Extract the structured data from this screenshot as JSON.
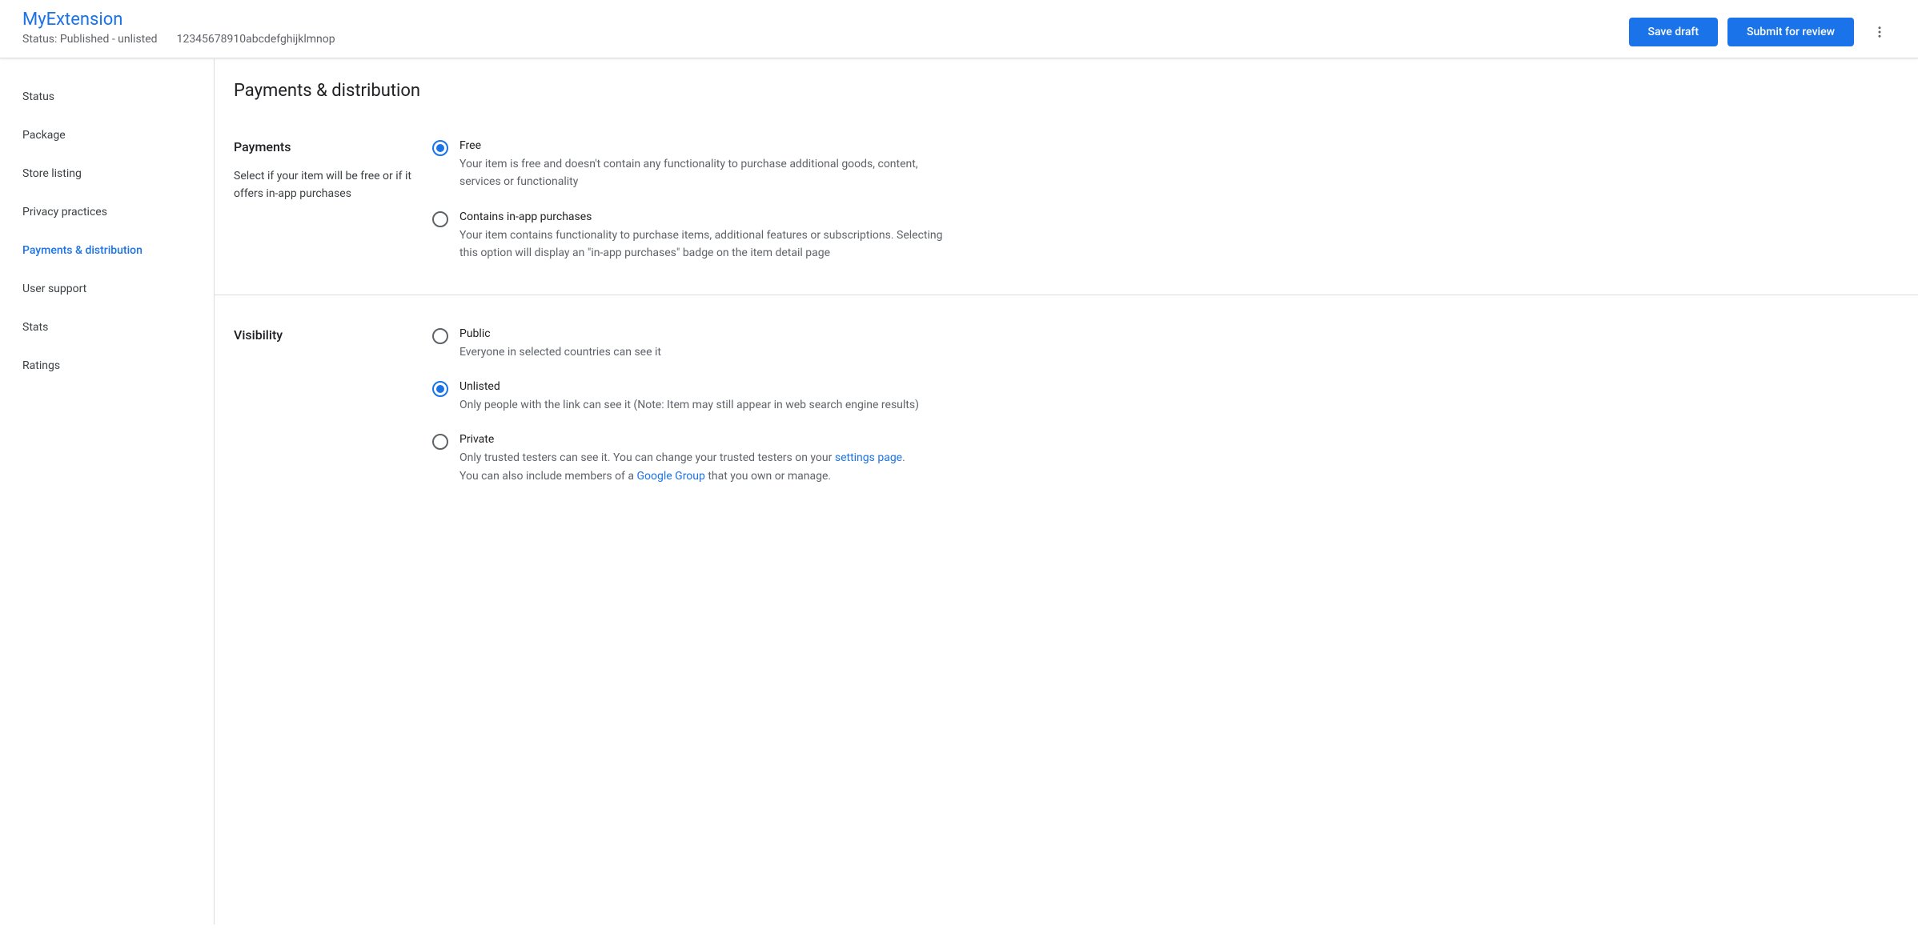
{
  "header": {
    "title": "MyExtension",
    "status": "Status: Published - unlisted",
    "id": "12345678910abcdefghijklmnop",
    "saveDraft": "Save draft",
    "submitReview": "Submit for review"
  },
  "sidebar": {
    "items": [
      {
        "label": "Status",
        "active": false
      },
      {
        "label": "Package",
        "active": false
      },
      {
        "label": "Store listing",
        "active": false
      },
      {
        "label": "Privacy practices",
        "active": false
      },
      {
        "label": "Payments & distribution",
        "active": true
      },
      {
        "label": "User support",
        "active": false
      },
      {
        "label": "Stats",
        "active": false
      },
      {
        "label": "Ratings",
        "active": false
      }
    ]
  },
  "main": {
    "title": "Payments & distribution",
    "payments": {
      "label": "Payments",
      "desc": "Select if your item will be free or if it offers in-app purchases",
      "options": [
        {
          "title": "Free",
          "desc": "Your item is free and doesn't contain any functionality to purchase additional goods, content, services or functionality",
          "checked": true
        },
        {
          "title": "Contains in-app purchases",
          "desc": "Your item contains functionality to purchase items, additional features or subscriptions. Selecting this option will display an \"in-app purchases\" badge on the item detail page",
          "checked": false
        }
      ]
    },
    "visibility": {
      "label": "Visibility",
      "options": [
        {
          "title": "Public",
          "desc": "Everyone in selected countries can see it",
          "checked": false
        },
        {
          "title": "Unlisted",
          "desc": "Only people with the link can see it (Note: Item may still appear in web search engine results)",
          "checked": true
        },
        {
          "title": "Private",
          "descPart1": "Only trusted testers can see it. You can change your trusted testers on your ",
          "link1": "settings page",
          "descPart2": ".",
          "descPart3": "You can also include members of a ",
          "link2": "Google Group",
          "descPart4": " that you own or manage.",
          "checked": false
        }
      ]
    }
  }
}
